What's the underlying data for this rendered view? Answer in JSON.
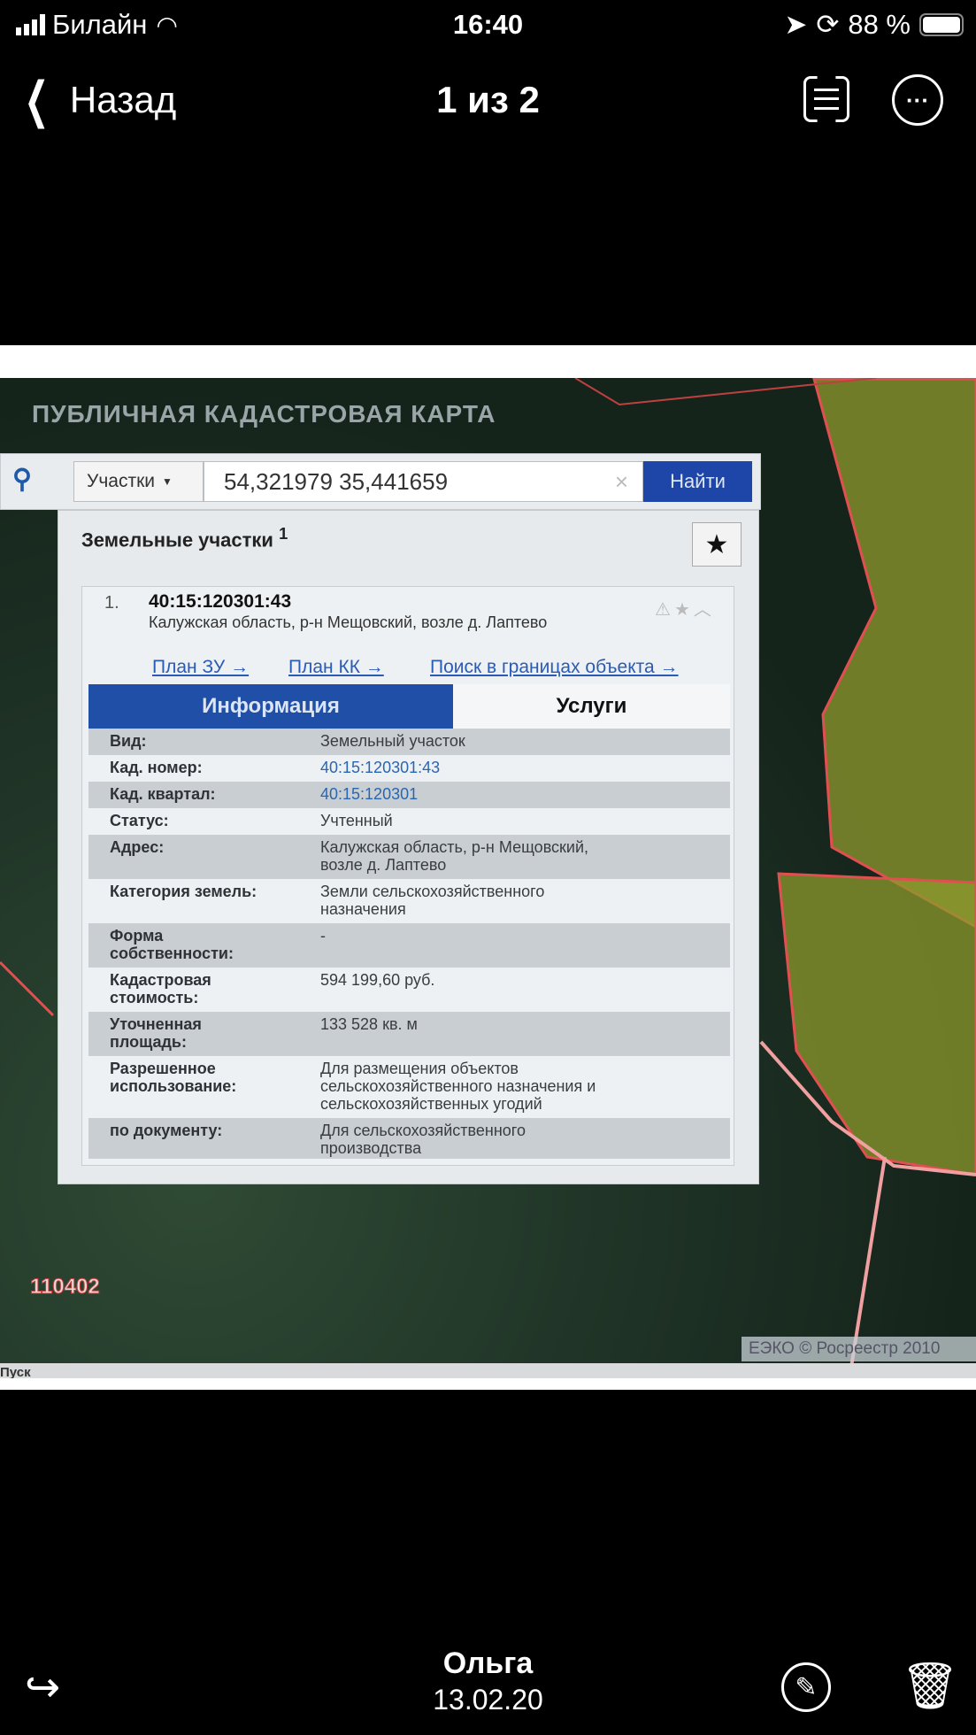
{
  "status_bar": {
    "carrier": "Билайн",
    "time": "16:40",
    "battery": "88 %"
  },
  "nav": {
    "back": "Назад",
    "title": "1 из 2"
  },
  "photo": {
    "map_title": "ПУБЛИЧНАЯ КАДАСТРОВАЯ КАРТА",
    "search": {
      "type": "Участки",
      "query": "54,321979 35,441659",
      "button": "Найти"
    },
    "results_header": "Земельные участки",
    "results_count": "1",
    "result": {
      "index": "1.",
      "number": "40:15:120301:43",
      "address": "Калужская область, р-н Мещовский, возле д. Лаптево",
      "links": [
        "План ЗУ →",
        "План КК →",
        "Поиск в границах объекта →"
      ]
    },
    "tabs": [
      "Информация",
      "Услуги"
    ],
    "rows": [
      {
        "label": "Вид:",
        "value": "Земельный участок"
      },
      {
        "label": "Кад. номер:",
        "value": "40:15:120301:43"
      },
      {
        "label": "Кад. квартал:",
        "value": "40:15:120301"
      },
      {
        "label": "Статус:",
        "value": "Учтенный"
      },
      {
        "label": "Адрес:",
        "value": "Калужская область, р-н Мещовский, возле д. Лаптево"
      },
      {
        "label": "Категория земель:",
        "value": "Земли сельскохозяйственного назначения"
      },
      {
        "label": "Форма собственности:",
        "value": "-"
      },
      {
        "label": "Кадастровая стоимость:",
        "value": "594 199,60 руб."
      },
      {
        "label": "Уточненная площадь:",
        "value": "133 528 кв. м"
      },
      {
        "label": "Разрешенное использование:",
        "value": "Для размещения объектов сельскохозяйственного назначения и сельскохозяйственных угодий"
      },
      {
        "label": "по документу:",
        "value": "Для сельскохозяйственного производства"
      }
    ],
    "map_label": "110402",
    "copyright": "ЕЭКО © Росреестр 2010",
    "taskbar": "Пуск"
  },
  "footer": {
    "name": "Ольга",
    "date": "13.02.20"
  }
}
